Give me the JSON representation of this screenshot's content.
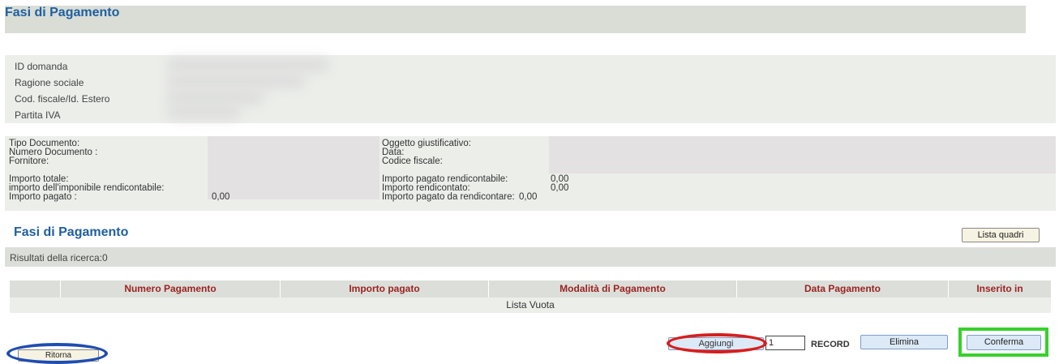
{
  "header": {
    "title": "Fasi di Pagamento"
  },
  "id_panel": {
    "labels": [
      "ID domanda",
      "Ragione sociale",
      "Cod. fiscale/Id. Estero",
      "Partita IVA"
    ]
  },
  "document": {
    "left": {
      "tipo_documento": "Tipo Documento:",
      "numero_documento": "Numero Documento :",
      "fornitore": "Fornitore:",
      "importo_totale": "Importo totale:",
      "imponibile": "importo dell'imponibile rendicontabile:",
      "importo_pagato": "Importo pagato :",
      "importo_pagato_value": "0,00"
    },
    "right": {
      "oggetto": "Oggetto giustificativo:",
      "data": "Data:",
      "codice_fiscale": "Codice fiscale:",
      "pagato_rendicontabile": "Importo pagato rendicontabile:",
      "pagato_rendicontabile_value": "0,00",
      "rendicontato": "Importo rendicontato:",
      "rendicontato_value": "0,00",
      "pagato_da_rendicontare": "Importo pagato da rendicontare:",
      "pagato_da_rendicontare_value": "0,00"
    }
  },
  "section": {
    "title": "Fasi di Pagamento",
    "lista_quadri_label": "Lista quadri",
    "results_label": "Risultati della ricerca:0"
  },
  "table": {
    "columns": [
      "",
      "Numero Pagamento",
      "Importo pagato",
      "Modalità di Pagamento",
      "Data Pagamento",
      "Inserito in"
    ],
    "rows": [],
    "empty_label": "Lista Vuota"
  },
  "footer": {
    "ritorna_label": "Ritorna",
    "aggiungi_label": "Aggiungi",
    "record_value": "1",
    "record_label": "RECORD",
    "elimina_label": "Elimina",
    "conferma_label": "Conferma"
  },
  "annotations": {
    "ritorna_color": "#1f4db0",
    "aggiungi_color": "#d81d1d",
    "conferma_color": "#37d12c"
  }
}
